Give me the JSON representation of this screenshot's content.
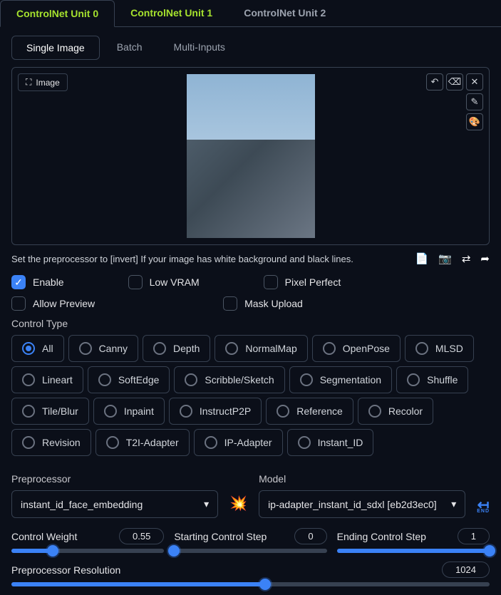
{
  "tabs": {
    "outer": [
      "ControlNet Unit 0",
      "ControlNet Unit 1",
      "ControlNet Unit 2"
    ],
    "inner": [
      "Single Image",
      "Batch",
      "Multi-Inputs"
    ]
  },
  "image_chip": "Image",
  "hint": "Set the preprocessor to [invert] If your image has white background and black lines.",
  "checks": {
    "enable": "Enable",
    "low_vram": "Low VRAM",
    "pixel_perfect": "Pixel Perfect",
    "allow_preview": "Allow Preview",
    "mask_upload": "Mask Upload"
  },
  "control_type_label": "Control Type",
  "control_types": [
    "All",
    "Canny",
    "Depth",
    "NormalMap",
    "OpenPose",
    "MLSD",
    "Lineart",
    "SoftEdge",
    "Scribble/Sketch",
    "Segmentation",
    "Shuffle",
    "Tile/Blur",
    "Inpaint",
    "InstructP2P",
    "Reference",
    "Recolor",
    "Revision",
    "T2I-Adapter",
    "IP-Adapter",
    "Instant_ID"
  ],
  "preprocessor": {
    "label": "Preprocessor",
    "value": "instant_id_face_embedding"
  },
  "model": {
    "label": "Model",
    "value": "ip-adapter_instant_id_sdxl [eb2d3ec0]"
  },
  "sliders": {
    "weight": {
      "label": "Control Weight",
      "value": "0.55",
      "pct": 27
    },
    "start": {
      "label": "Starting Control Step",
      "value": "0",
      "pct": 0
    },
    "end": {
      "label": "Ending Control Step",
      "value": "1",
      "pct": 100
    },
    "res": {
      "label": "Preprocessor Resolution",
      "value": "1024",
      "pct": 53
    }
  }
}
